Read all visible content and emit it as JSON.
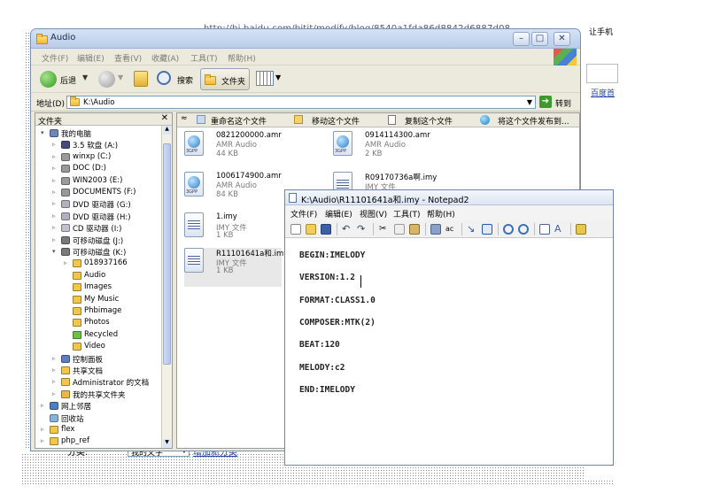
{
  "browser": {
    "url_fragment": "http://hi.baidu.com/bitit/modify/blog/8540a1fda86d8842d6887d08",
    "right_text_top": "让手机",
    "right_text_link": "百度首"
  },
  "explorer": {
    "title": "Audio",
    "menu": [
      "文件(F)",
      "编辑(E)",
      "查看(V)",
      "收藏(A)",
      "工具(T)",
      "帮助(H)"
    ],
    "toolbar": {
      "back": "后退",
      "search": "搜索",
      "folders": "文件夹"
    },
    "address_label": "地址(D)",
    "address_value": "K:\\Audio",
    "go_label": "转到",
    "folders_header": "文件夹",
    "tasks": [
      "重命名这个文件",
      "移动这个文件",
      "复制这个文件",
      "将这个文件发布到..."
    ],
    "tree": [
      {
        "label": "我的电脑",
        "icon": "my-computer-icon",
        "level": 0
      },
      {
        "label": "3.5 软盘 (A:)",
        "icon": "floppy-icon",
        "level": 1
      },
      {
        "label": "winxp (C:)",
        "icon": "drive-icon",
        "level": 1
      },
      {
        "label": "DOC (D:)",
        "icon": "drive-icon",
        "level": 1
      },
      {
        "label": "WIN2003 (E:)",
        "icon": "drive-icon",
        "level": 1
      },
      {
        "label": "DOCUMENTS (F:)",
        "icon": "drive-icon",
        "level": 1
      },
      {
        "label": "DVD 驱动器 (G:)",
        "icon": "dvd-icon",
        "level": 1
      },
      {
        "label": "DVD 驱动器 (H:)",
        "icon": "dvd-icon",
        "level": 1
      },
      {
        "label": "CD 驱动器 (I:)",
        "icon": "cd-icon",
        "level": 1
      },
      {
        "label": "可移动磁盘 (J:)",
        "icon": "removable-disk-icon",
        "level": 1
      },
      {
        "label": "可移动磁盘 (K:)",
        "icon": "removable-disk-icon",
        "level": 1
      },
      {
        "label": "018937166",
        "icon": "folder-icon",
        "level": 2
      },
      {
        "label": "Audio",
        "icon": "folder-icon",
        "level": 2
      },
      {
        "label": "Images",
        "icon": "folder-icon",
        "level": 2
      },
      {
        "label": "My Music",
        "icon": "folder-icon",
        "level": 2
      },
      {
        "label": "Phbimage",
        "icon": "folder-icon",
        "level": 2
      },
      {
        "label": "Photos",
        "icon": "folder-icon",
        "level": 2
      },
      {
        "label": "Recycled",
        "icon": "recycle-folder-icon",
        "level": 2
      },
      {
        "label": "Video",
        "icon": "folder-icon",
        "level": 2
      },
      {
        "label": "控制面板",
        "icon": "control-panel-icon",
        "level": 1
      },
      {
        "label": "共享文档",
        "icon": "folder-icon",
        "level": 1
      },
      {
        "label": "Administrator 的文档",
        "icon": "folder-icon",
        "level": 1
      },
      {
        "label": "我的共享文件夹",
        "icon": "shared-folder-icon",
        "level": 1
      },
      {
        "label": "网上邻居",
        "icon": "network-icon",
        "level": 0
      },
      {
        "label": "回收站",
        "icon": "recycle-bin-icon",
        "level": 0
      },
      {
        "label": "flex",
        "icon": "folder-icon",
        "level": 0
      },
      {
        "label": "php_ref",
        "icon": "folder-icon",
        "level": 0
      }
    ],
    "files": [
      {
        "name": "0821200000.amr",
        "type": "AMR Audio",
        "size": "44 KB",
        "icon": "3gpp-file-icon"
      },
      {
        "name": "0914114300.amr",
        "type": "AMR Audio",
        "size": "2 KB",
        "icon": "3gpp-file-icon"
      },
      {
        "name": "1006174900.amr",
        "type": "AMR Audio",
        "size": "84 KB",
        "icon": "3gpp-file-icon"
      },
      {
        "name": "R09170736a啊.imy",
        "type": "IMY 文件",
        "size": "",
        "icon": "imy-file-icon"
      },
      {
        "name": "1.imy",
        "type": "IMY 文件",
        "size": "1 KB",
        "icon": "imy-file-icon"
      },
      {
        "name": "R11101641a和.imy",
        "type": "IMY 文件",
        "size": "1 KB",
        "icon": "imy-file-icon"
      }
    ]
  },
  "notepad": {
    "title": "K:\\Audio\\R11101641a和.imy - Notepad2",
    "menu": [
      "文件(F)",
      "编辑(E)",
      "视图(V)",
      "工具(T)",
      "帮助(H)"
    ],
    "lines": [
      "BEGIN:IMELODY",
      "VERSION:1.2",
      "FORMAT:CLASS1.0",
      "COMPOSER:MTK(2)",
      "BEAT:120",
      "MELODY:c2",
      "END:IMELODY"
    ]
  },
  "behind": {
    "category_label": "分类:",
    "category_value": "我的文字",
    "add_category": "增加新分类"
  }
}
